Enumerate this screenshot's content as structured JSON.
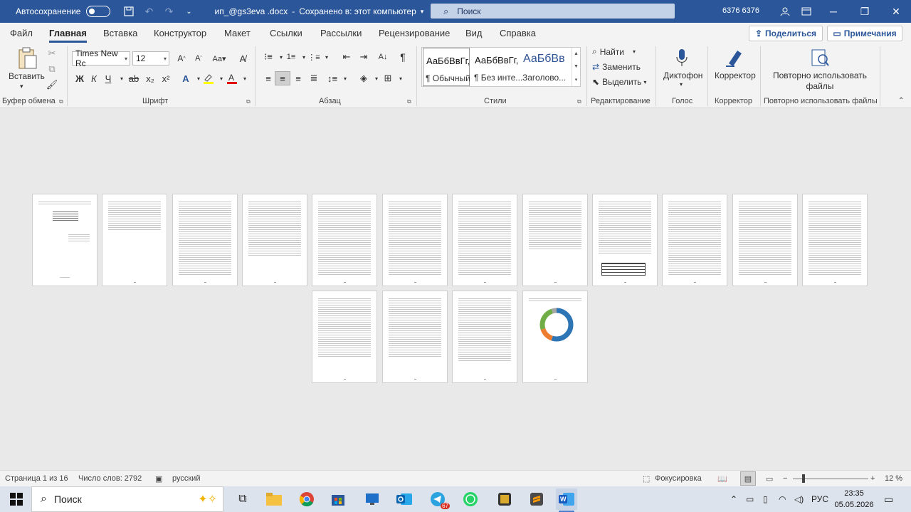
{
  "titlebar": {
    "autosave_label": "Автосохранение",
    "doc_name": "ип_@gs3eva .docx",
    "save_status": "Сохранено в: этот компьютер",
    "search_placeholder": "Поиск",
    "user": "6376 6376"
  },
  "tabs": [
    "Файл",
    "Главная",
    "Вставка",
    "Конструктор",
    "Макет",
    "Ссылки",
    "Рассылки",
    "Рецензирование",
    "Вид",
    "Справка"
  ],
  "active_tab": "Главная",
  "share_label": "Поделиться",
  "comments_label": "Примечания",
  "ribbon": {
    "clipboard": {
      "paste_label": "Вставить",
      "group_label": "Буфер обмена"
    },
    "font": {
      "font_name": "Times New Rc",
      "font_size": "12",
      "group_label": "Шрифт",
      "bold": "Ж",
      "italic": "К",
      "underline": "Ч",
      "strike": "ab",
      "subscript": "x₂",
      "superscript": "x²"
    },
    "paragraph": {
      "group_label": "Абзац"
    },
    "styles": {
      "group_label": "Стили",
      "items": [
        {
          "preview": "АаБбВвГг,",
          "name": "¶ Обычный"
        },
        {
          "preview": "АаБбВвГг,",
          "name": "¶ Без инте..."
        },
        {
          "preview": "АаБбВв",
          "name": "Заголово..."
        }
      ]
    },
    "editing": {
      "find": "Найти",
      "replace": "Заменить",
      "select": "Выделить",
      "group_label": "Редактирование"
    },
    "voice": {
      "dictate": "Диктофон",
      "group_label": "Голос"
    },
    "editor": {
      "label": "Корректор",
      "group_label": "Корректор"
    },
    "reuse": {
      "label": "Повторно использовать файлы",
      "group_label": "Повторно использовать файлы"
    }
  },
  "status": {
    "page": "Страница 1 из 16",
    "words": "Число слов: 2792",
    "language": "русский",
    "focus": "Фокусировка",
    "zoom": "12 %"
  },
  "taskbar": {
    "search_label": "Поиск",
    "language": "РУС",
    "time": "23:35",
    "date": "05.05.2026",
    "telegram_badge": "67"
  },
  "chart_colors": [
    "#2e75b6",
    "#ed7d31",
    "#70ad47",
    "#a5a5a5"
  ]
}
